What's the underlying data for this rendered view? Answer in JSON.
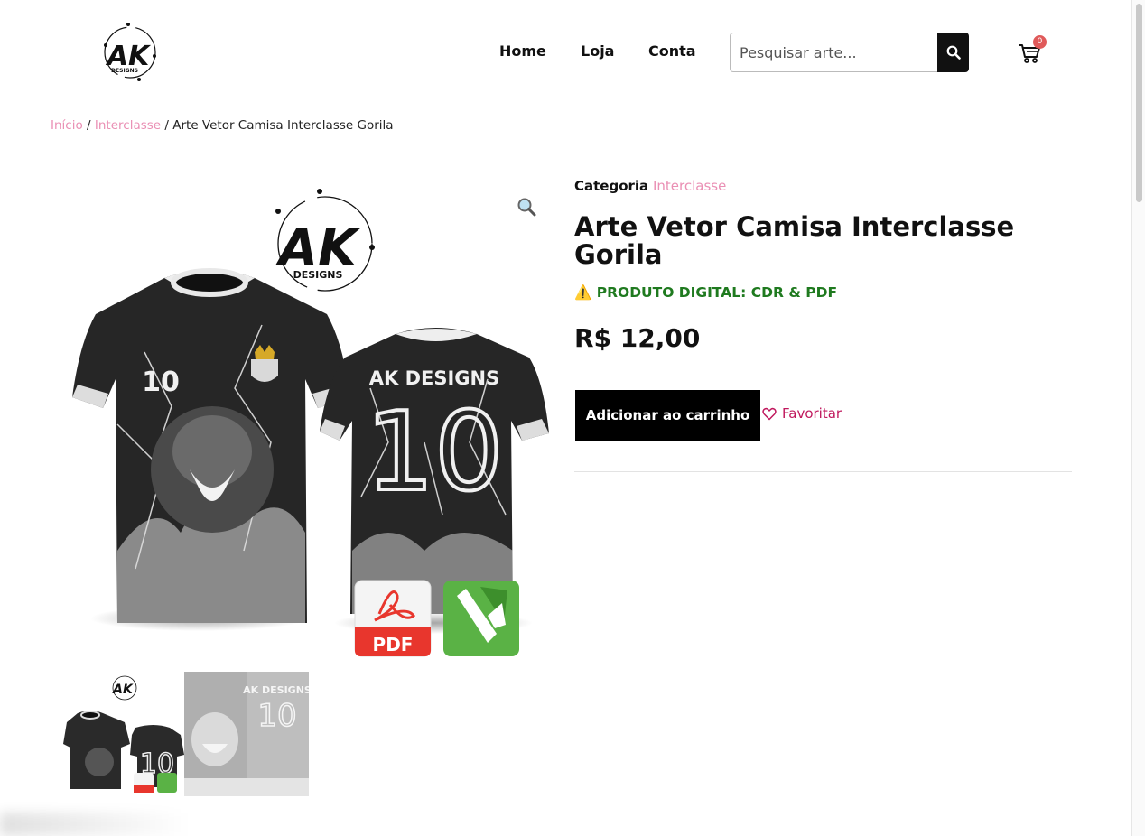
{
  "header": {
    "logo_brand": "AK",
    "logo_sub": "DESIGNS",
    "nav": {
      "home": "Home",
      "loja": "Loja",
      "conta": "Conta"
    },
    "search_placeholder": "Pesquisar arte...",
    "cart_count": "0"
  },
  "breadcrumb": {
    "inicio": "Início",
    "sep1": " / ",
    "category": "Interclasse",
    "sep2": " / ",
    "current": "Arte Vetor Camisa Interclasse Gorila"
  },
  "gallery": {
    "image_logo_brand": "AK",
    "image_logo_sub": "DESIGNS",
    "jersey_back_text": "AK DESIGNS",
    "jersey_number": "10",
    "pdf_label": "PDF"
  },
  "product": {
    "category_label": "Categoria",
    "category_value": "Interclasse",
    "title": "Arte Vetor Camisa Interclasse Gorila",
    "notice_icon": "⚠️",
    "notice_text": "PRODUTO DIGITAL: CDR & PDF",
    "price": "R$ 12,00",
    "add_to_cart": "Adicionar ao carrinho",
    "favorite": "Favoritar"
  },
  "colors": {
    "accent_pink": "#ea8fb4",
    "favorite_pink": "#c0185d",
    "notice_green": "#1f7a1f",
    "badge_red": "#e05a5a"
  },
  "icons": [
    "search-icon",
    "cart-icon",
    "zoom-icon",
    "heart-icon",
    "warning-icon",
    "pdf-icon",
    "coreldraw-icon"
  ]
}
